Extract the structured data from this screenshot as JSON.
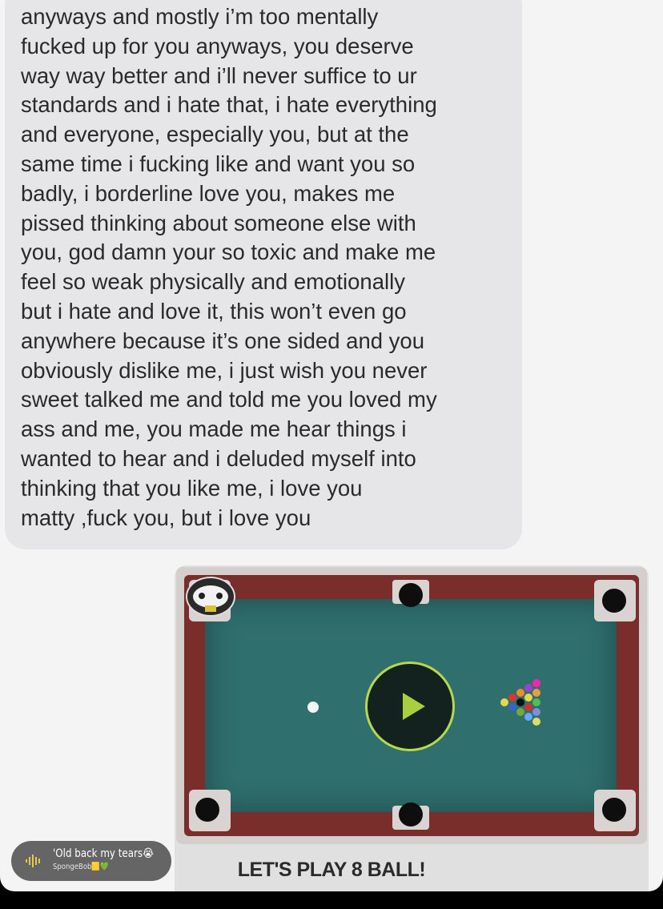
{
  "message": {
    "lines": [
      "anyways and mostly i’m too mentally",
      "fucked up for you anyways, you deserve",
      "way way better and i’ll never suffice to ur",
      "standards and i hate that, i hate everything",
      "and everyone, especially you, but at the",
      "same time i fucking like and want you so",
      "badly, i borderline love you, makes me",
      "pissed thinking about someone else with",
      "you, god damn your so toxic and make me",
      "feel so weak physically and emotionally",
      "but i hate and love it, this won’t even go",
      "anywhere because it’s one sided and you",
      "obviously dislike me, i just wish you never",
      "sweet talked me and told me you loved my",
      "ass and me, you made me hear things i",
      "wanted to hear and i deluded myself into",
      "thinking that you like me, i love you",
      "matty ,fuck you, but i love you"
    ]
  },
  "game_card": {
    "title": "LET'S PLAY 8 BALL!",
    "play_icon": "play-icon",
    "accent": "#b6d84a",
    "felt_color": "#2f6f6e",
    "rail_color": "#7a2e2c"
  },
  "music_sticker": {
    "title": "'Old back my tears😭",
    "artist": "SpongeBob🟨💚",
    "icon": "soundwave-icon"
  }
}
